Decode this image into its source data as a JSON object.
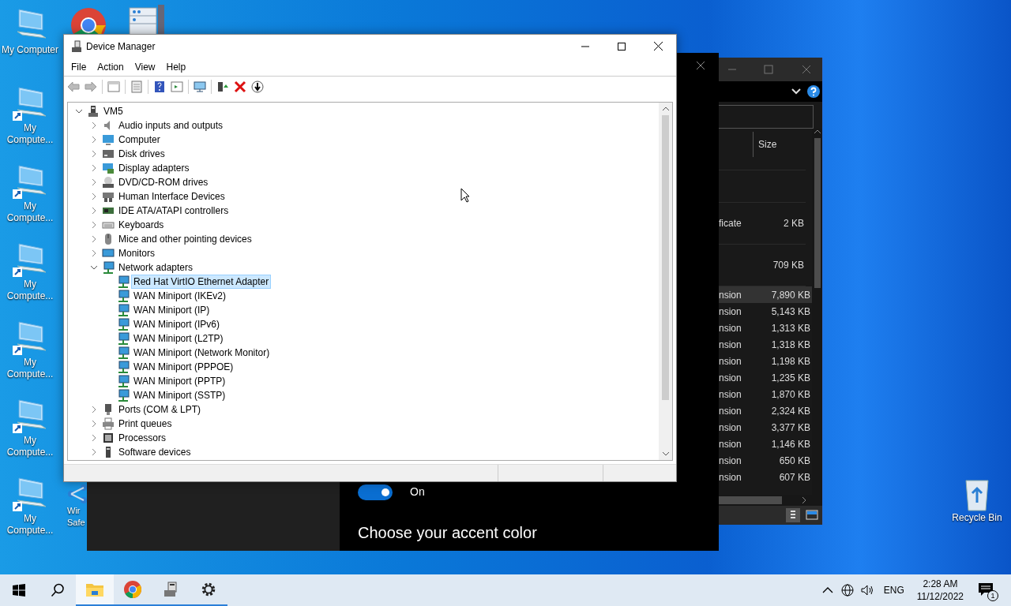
{
  "desktop_icons": [
    {
      "label": "My Computer",
      "shortcut": false
    },
    {
      "label": "My Compute...",
      "shortcut": true
    },
    {
      "label": "My Compute...",
      "shortcut": true
    },
    {
      "label": "My Compute...",
      "shortcut": true
    },
    {
      "label": "My Compute...",
      "shortcut": true
    },
    {
      "label": "My Compute...",
      "shortcut": true
    },
    {
      "label": "My Compute...",
      "shortcut": true
    }
  ],
  "partial_desktop_icon": {
    "label": "Wir Safe"
  },
  "recycle_bin": {
    "label": "Recycle Bin"
  },
  "settings_window": {
    "toggle": {
      "on": true,
      "label": "On"
    },
    "heading": "Choose your accent color"
  },
  "explorer_window": {
    "column": "Size",
    "rows": [
      {
        "kind": "tall",
        "name": "ficate",
        "size": "2 KB",
        "selected": false
      },
      {
        "kind": "tall",
        "name": "",
        "size": "709 KB",
        "selected": false
      },
      {
        "kind": "row",
        "name": "nsion",
        "size": "7,890 KB",
        "selected": true
      },
      {
        "kind": "row",
        "name": "nsion",
        "size": "5,143 KB",
        "selected": false
      },
      {
        "kind": "row",
        "name": "nsion",
        "size": "1,313 KB",
        "selected": false
      },
      {
        "kind": "row",
        "name": "nsion",
        "size": "1,318 KB",
        "selected": false
      },
      {
        "kind": "row",
        "name": "nsion",
        "size": "1,198 KB",
        "selected": false
      },
      {
        "kind": "row",
        "name": "nsion",
        "size": "1,235 KB",
        "selected": false
      },
      {
        "kind": "row",
        "name": "nsion",
        "size": "1,870 KB",
        "selected": false
      },
      {
        "kind": "row",
        "name": "nsion",
        "size": "2,324 KB",
        "selected": false
      },
      {
        "kind": "row",
        "name": "nsion",
        "size": "3,377 KB",
        "selected": false
      },
      {
        "kind": "row",
        "name": "nsion",
        "size": "1,146 KB",
        "selected": false
      },
      {
        "kind": "row",
        "name": "nsion",
        "size": "650 KB",
        "selected": false
      },
      {
        "kind": "row",
        "name": "nsion",
        "size": "607 KB",
        "selected": false
      }
    ]
  },
  "device_manager": {
    "title": "Device Manager",
    "menu": [
      "File",
      "Action",
      "View",
      "Help"
    ],
    "tree": {
      "label": "VM5",
      "kind": "computer-root",
      "expanded": true,
      "selected": false,
      "children": [
        {
          "label": "Audio inputs and outputs",
          "kind": "audio",
          "expanded": false,
          "selected": false
        },
        {
          "label": "Computer",
          "kind": "computer",
          "expanded": false,
          "selected": false
        },
        {
          "label": "Disk drives",
          "kind": "disk",
          "expanded": false,
          "selected": false
        },
        {
          "label": "Display adapters",
          "kind": "display",
          "expanded": false,
          "selected": false
        },
        {
          "label": "DVD/CD-ROM drives",
          "kind": "dvd",
          "expanded": false,
          "selected": false
        },
        {
          "label": "Human Interface Devices",
          "kind": "hid",
          "expanded": false,
          "selected": false
        },
        {
          "label": "IDE ATA/ATAPI controllers",
          "kind": "ide",
          "expanded": false,
          "selected": false
        },
        {
          "label": "Keyboards",
          "kind": "keyboard",
          "expanded": false,
          "selected": false
        },
        {
          "label": "Mice and other pointing devices",
          "kind": "mouse",
          "expanded": false,
          "selected": false
        },
        {
          "label": "Monitors",
          "kind": "monitor",
          "expanded": false,
          "selected": false
        },
        {
          "label": "Network adapters",
          "kind": "network",
          "expanded": true,
          "selected": false,
          "children": [
            {
              "label": "Red Hat VirtIO Ethernet Adapter",
              "kind": "network",
              "selected": true
            },
            {
              "label": "WAN Miniport (IKEv2)",
              "kind": "network",
              "selected": false
            },
            {
              "label": "WAN Miniport (IP)",
              "kind": "network",
              "selected": false
            },
            {
              "label": "WAN Miniport (IPv6)",
              "kind": "network",
              "selected": false
            },
            {
              "label": "WAN Miniport (L2TP)",
              "kind": "network",
              "selected": false
            },
            {
              "label": "WAN Miniport (Network Monitor)",
              "kind": "network",
              "selected": false
            },
            {
              "label": "WAN Miniport (PPPOE)",
              "kind": "network",
              "selected": false
            },
            {
              "label": "WAN Miniport (PPTP)",
              "kind": "network",
              "selected": false
            },
            {
              "label": "WAN Miniport (SSTP)",
              "kind": "network",
              "selected": false
            }
          ]
        },
        {
          "label": "Ports (COM & LPT)",
          "kind": "ports",
          "expanded": false,
          "selected": false
        },
        {
          "label": "Print queues",
          "kind": "printer",
          "expanded": false,
          "selected": false
        },
        {
          "label": "Processors",
          "kind": "processor",
          "expanded": false,
          "selected": false
        },
        {
          "label": "Software devices",
          "kind": "software",
          "expanded": false,
          "selected": false
        }
      ]
    }
  },
  "taskbar": {
    "apps": [
      {
        "kind": "explorer",
        "selected": true
      },
      {
        "kind": "chrome",
        "selected": false
      },
      {
        "kind": "devmgr",
        "selected": false
      },
      {
        "kind": "settings",
        "selected": false
      }
    ],
    "language": "ENG",
    "time": "2:28 AM",
    "date": "11/12/2022",
    "notifications": "1"
  }
}
